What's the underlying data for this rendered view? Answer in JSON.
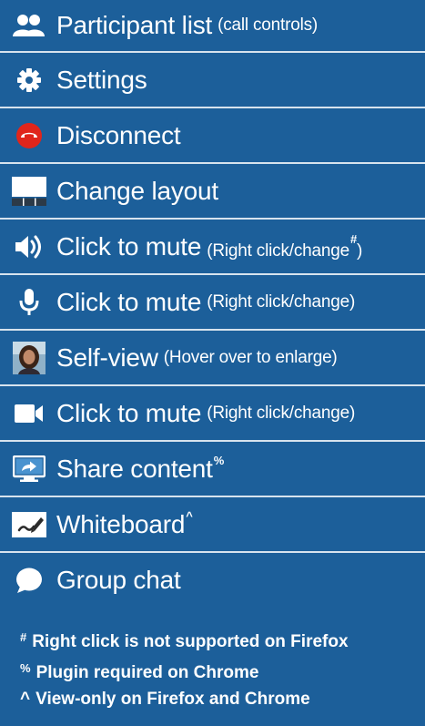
{
  "menu": {
    "participant": {
      "label": "Participant list",
      "sub": "(call controls)"
    },
    "settings": {
      "label": "Settings"
    },
    "disconnect": {
      "label": "Disconnect"
    },
    "layout": {
      "label": "Change layout"
    },
    "speaker": {
      "label": "Click to mute",
      "sub": "(Right click/change",
      "sup": "#",
      "sub_end": ")"
    },
    "mic": {
      "label": "Click to mute",
      "sub": "(Right click/change)"
    },
    "selfview": {
      "label": "Self-view",
      "sub": "(Hover over to enlarge)"
    },
    "camera": {
      "label": "Click to mute",
      "sub": "(Right click/change)"
    },
    "share": {
      "label": "Share content",
      "sup": "%"
    },
    "whiteboard": {
      "label": "Whiteboard",
      "sup": "^"
    },
    "chat": {
      "label": "Group chat"
    }
  },
  "notes": [
    {
      "symbol": "#",
      "text": "Right click is not supported on Firefox"
    },
    {
      "symbol": "%",
      "text": "Plugin required on Chrome"
    },
    {
      "symbol": "^",
      "text": "View-only on Firefox and Chrome"
    }
  ],
  "colors": {
    "background": "#1c5f9a",
    "divider": "#d7e3ee",
    "disconnect_red": "#e0251b",
    "text": "#ffffff"
  },
  "icons": [
    "participants-icon",
    "gear-icon",
    "hangup-icon",
    "layout-icon",
    "speaker-icon",
    "microphone-icon",
    "self-view-thumbnail",
    "camera-icon",
    "share-screen-icon",
    "whiteboard-icon",
    "chat-bubble-icon"
  ]
}
